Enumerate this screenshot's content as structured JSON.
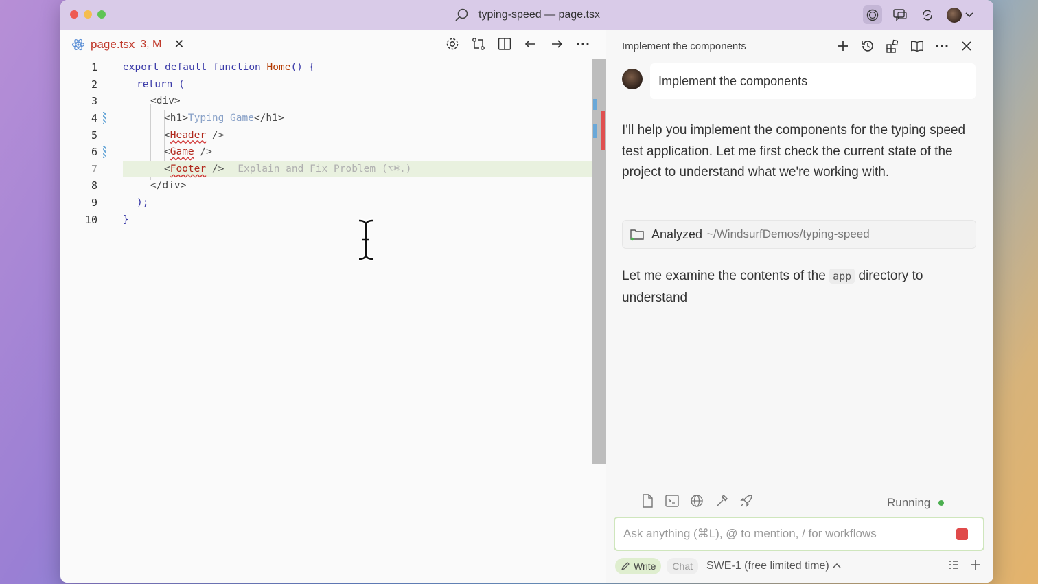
{
  "window": {
    "title": "typing-speed — page.tsx"
  },
  "editor": {
    "tab": {
      "name": "page.tsx",
      "status": "3, M"
    },
    "lines": [
      {
        "no": "1"
      },
      {
        "no": "2"
      },
      {
        "no": "3"
      },
      {
        "no": "4"
      },
      {
        "no": "5"
      },
      {
        "no": "6"
      },
      {
        "no": "7"
      },
      {
        "no": "8"
      },
      {
        "no": "9"
      },
      {
        "no": "10"
      }
    ],
    "code": {
      "l1_kw": "export default function",
      "l1_fn": "Home",
      "l1_rest": "() {",
      "l2": "return (",
      "l3": "<div>",
      "l4_open": "<h1>",
      "l4_text": "Typing Game",
      "l4_close": "</h1>",
      "l5_open": "<",
      "l5_name": "Header",
      "l5_close": " />",
      "l6_open": "<",
      "l6_name": "Game",
      "l6_close": " />",
      "l7_open": "<",
      "l7_name": "Footer",
      "l7_close": " />",
      "l7_hint": "Explain and Fix Problem (⌥⌘.)",
      "l8": "</div>",
      "l9": ");",
      "l10": "}"
    }
  },
  "chat": {
    "header_title": "Implement the components",
    "user_message": "Implement the components",
    "reply": "I'll help you implement the components for the typing speed test application. Let me first check the current state of the project to understand what we're working with.",
    "analyzed_label": "Analyzed",
    "analyzed_path": "~/WindsurfDemos/typing-speed",
    "reply2_before": "Let me examine the contents of the",
    "reply2_code": "app",
    "reply2_after": "directory to understand",
    "status": "Running",
    "input_placeholder": "Ask anything (⌘L), @ to mention, / for workflows",
    "mode_write": "Write",
    "mode_chat": "Chat",
    "model": "SWE-1 (free limited time)"
  }
}
